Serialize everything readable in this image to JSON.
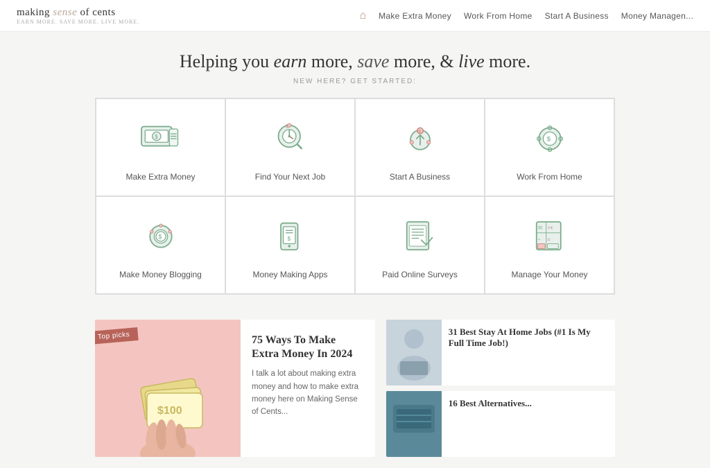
{
  "header": {
    "logo_main": "making ",
    "logo_italic": "sense",
    "logo_rest": " of cents",
    "logo_sub": "earn more. save more. live more.",
    "nav_items": [
      {
        "label": "Make Extra Money",
        "id": "nav-make-extra-money"
      },
      {
        "label": "Work From Home",
        "id": "nav-work-from-home"
      },
      {
        "label": "Start A Business",
        "id": "nav-start-a-business"
      },
      {
        "label": "Money Managen...",
        "id": "nav-money-management"
      }
    ]
  },
  "hero": {
    "headline_start": "Helping you ",
    "headline_earn": "earn",
    "headline_mid": " more, ",
    "headline_save": "save",
    "headline_mid2": " more, & ",
    "headline_live": "live",
    "headline_end": " more.",
    "subtitle": "NEW HERE? GET STARTED:"
  },
  "grid": {
    "items": [
      {
        "label": "Make Extra Money",
        "id": "make-extra-money",
        "icon": "money"
      },
      {
        "label": "Find Your Next Job",
        "id": "find-next-job",
        "icon": "job"
      },
      {
        "label": "Start A Business",
        "id": "start-business",
        "icon": "business"
      },
      {
        "label": "Work From Home",
        "id": "work-from-home",
        "icon": "home"
      },
      {
        "label": "Make Money Blogging",
        "id": "make-money-blogging",
        "icon": "blog"
      },
      {
        "label": "Money Making Apps",
        "id": "money-apps",
        "icon": "apps"
      },
      {
        "label": "Paid Online Surveys",
        "id": "paid-surveys",
        "icon": "surveys"
      },
      {
        "label": "Manage Your Money",
        "id": "manage-money",
        "icon": "manage"
      }
    ]
  },
  "articles": {
    "main": {
      "badge": "Top picks",
      "title": "75 Ways To Make Extra Money In 2024",
      "excerpt": "I talk a lot about making extra money and how to make extra money here on Making Sense of Cents..."
    },
    "side": [
      {
        "title": "31 Best Stay At Home Jobs (#1 Is My Full Time Job!)"
      },
      {
        "title": "16 Best Alternatives..."
      }
    ]
  },
  "colors": {
    "accent": "#c0857a",
    "badge_bg": "#b8635a",
    "light_pink": "#f4c5c0"
  }
}
